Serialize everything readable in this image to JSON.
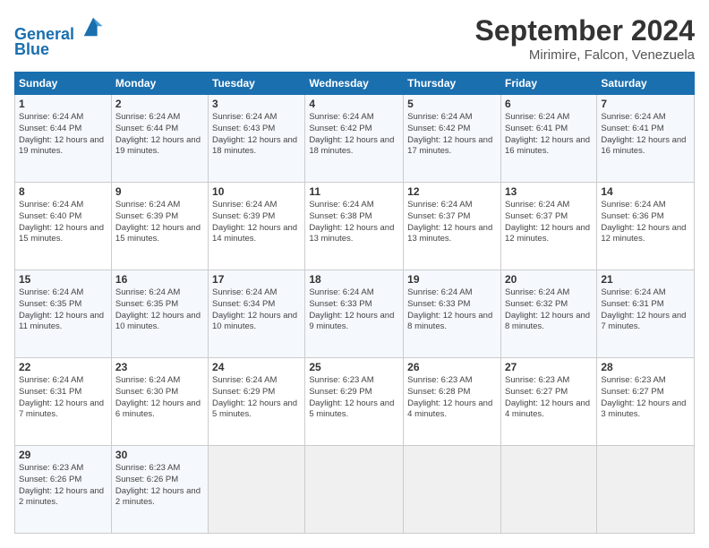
{
  "logo": {
    "line1": "General",
    "line2": "Blue"
  },
  "title": "September 2024",
  "location": "Mirimire, Falcon, Venezuela",
  "days_header": [
    "Sunday",
    "Monday",
    "Tuesday",
    "Wednesday",
    "Thursday",
    "Friday",
    "Saturday"
  ],
  "weeks": [
    [
      {
        "day": "1",
        "sunrise": "6:24 AM",
        "sunset": "6:44 PM",
        "daylight": "12 hours and 19 minutes."
      },
      {
        "day": "2",
        "sunrise": "6:24 AM",
        "sunset": "6:44 PM",
        "daylight": "12 hours and 19 minutes."
      },
      {
        "day": "3",
        "sunrise": "6:24 AM",
        "sunset": "6:43 PM",
        "daylight": "12 hours and 18 minutes."
      },
      {
        "day": "4",
        "sunrise": "6:24 AM",
        "sunset": "6:42 PM",
        "daylight": "12 hours and 18 minutes."
      },
      {
        "day": "5",
        "sunrise": "6:24 AM",
        "sunset": "6:42 PM",
        "daylight": "12 hours and 17 minutes."
      },
      {
        "day": "6",
        "sunrise": "6:24 AM",
        "sunset": "6:41 PM",
        "daylight": "12 hours and 16 minutes."
      },
      {
        "day": "7",
        "sunrise": "6:24 AM",
        "sunset": "6:41 PM",
        "daylight": "12 hours and 16 minutes."
      }
    ],
    [
      {
        "day": "8",
        "sunrise": "6:24 AM",
        "sunset": "6:40 PM",
        "daylight": "12 hours and 15 minutes."
      },
      {
        "day": "9",
        "sunrise": "6:24 AM",
        "sunset": "6:39 PM",
        "daylight": "12 hours and 15 minutes."
      },
      {
        "day": "10",
        "sunrise": "6:24 AM",
        "sunset": "6:39 PM",
        "daylight": "12 hours and 14 minutes."
      },
      {
        "day": "11",
        "sunrise": "6:24 AM",
        "sunset": "6:38 PM",
        "daylight": "12 hours and 13 minutes."
      },
      {
        "day": "12",
        "sunrise": "6:24 AM",
        "sunset": "6:37 PM",
        "daylight": "12 hours and 13 minutes."
      },
      {
        "day": "13",
        "sunrise": "6:24 AM",
        "sunset": "6:37 PM",
        "daylight": "12 hours and 12 minutes."
      },
      {
        "day": "14",
        "sunrise": "6:24 AM",
        "sunset": "6:36 PM",
        "daylight": "12 hours and 12 minutes."
      }
    ],
    [
      {
        "day": "15",
        "sunrise": "6:24 AM",
        "sunset": "6:35 PM",
        "daylight": "12 hours and 11 minutes."
      },
      {
        "day": "16",
        "sunrise": "6:24 AM",
        "sunset": "6:35 PM",
        "daylight": "12 hours and 10 minutes."
      },
      {
        "day": "17",
        "sunrise": "6:24 AM",
        "sunset": "6:34 PM",
        "daylight": "12 hours and 10 minutes."
      },
      {
        "day": "18",
        "sunrise": "6:24 AM",
        "sunset": "6:33 PM",
        "daylight": "12 hours and 9 minutes."
      },
      {
        "day": "19",
        "sunrise": "6:24 AM",
        "sunset": "6:33 PM",
        "daylight": "12 hours and 8 minutes."
      },
      {
        "day": "20",
        "sunrise": "6:24 AM",
        "sunset": "6:32 PM",
        "daylight": "12 hours and 8 minutes."
      },
      {
        "day": "21",
        "sunrise": "6:24 AM",
        "sunset": "6:31 PM",
        "daylight": "12 hours and 7 minutes."
      }
    ],
    [
      {
        "day": "22",
        "sunrise": "6:24 AM",
        "sunset": "6:31 PM",
        "daylight": "12 hours and 7 minutes."
      },
      {
        "day": "23",
        "sunrise": "6:24 AM",
        "sunset": "6:30 PM",
        "daylight": "12 hours and 6 minutes."
      },
      {
        "day": "24",
        "sunrise": "6:24 AM",
        "sunset": "6:29 PM",
        "daylight": "12 hours and 5 minutes."
      },
      {
        "day": "25",
        "sunrise": "6:23 AM",
        "sunset": "6:29 PM",
        "daylight": "12 hours and 5 minutes."
      },
      {
        "day": "26",
        "sunrise": "6:23 AM",
        "sunset": "6:28 PM",
        "daylight": "12 hours and 4 minutes."
      },
      {
        "day": "27",
        "sunrise": "6:23 AM",
        "sunset": "6:27 PM",
        "daylight": "12 hours and 4 minutes."
      },
      {
        "day": "28",
        "sunrise": "6:23 AM",
        "sunset": "6:27 PM",
        "daylight": "12 hours and 3 minutes."
      }
    ],
    [
      {
        "day": "29",
        "sunrise": "6:23 AM",
        "sunset": "6:26 PM",
        "daylight": "12 hours and 2 minutes."
      },
      {
        "day": "30",
        "sunrise": "6:23 AM",
        "sunset": "6:26 PM",
        "daylight": "12 hours and 2 minutes."
      },
      null,
      null,
      null,
      null,
      null
    ]
  ]
}
